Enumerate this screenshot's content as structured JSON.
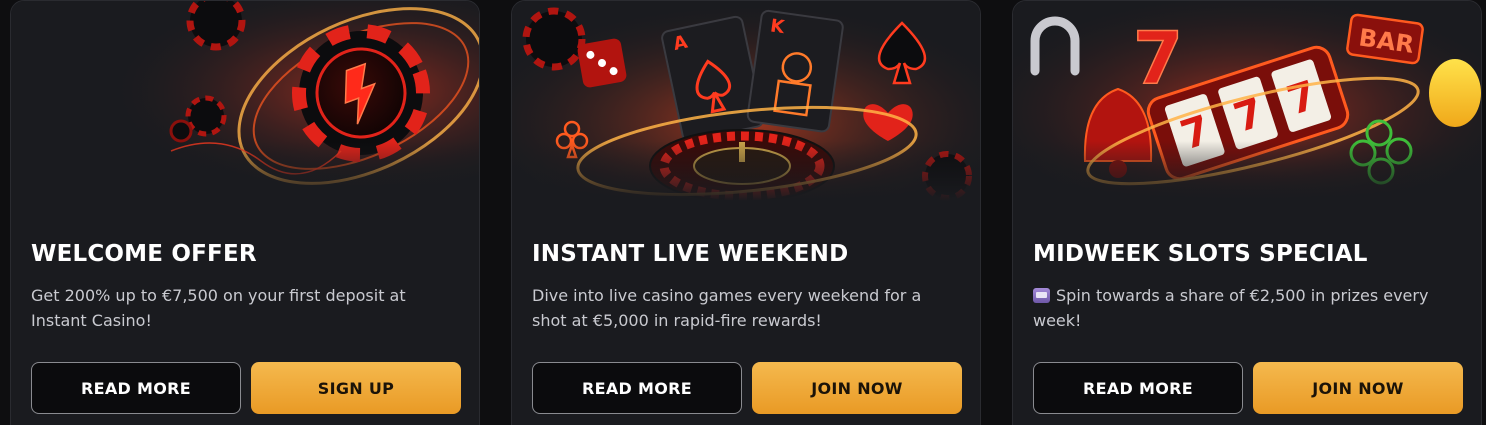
{
  "colors": {
    "page_bg": "#0e0e10",
    "card_bg": "#1a1b1f",
    "accent_gold": "#f0a83a",
    "accent_red": "#e2231a"
  },
  "promos": [
    {
      "banner_icon": "poker-chip-lightning-icon",
      "title": "WELCOME OFFER",
      "description": "Get 200% up to €7,500 on your first deposit at Instant Casino!",
      "secondary_button": "READ MORE",
      "primary_button": "SIGN UP"
    },
    {
      "banner_icon": "playing-cards-roulette-icon",
      "title": "INSTANT LIVE WEEKEND",
      "description": "Dive into live casino games every weekend for a shot at €5,000 in rapid-fire rewards!",
      "secondary_button": "READ MORE",
      "primary_button": "JOIN NOW"
    },
    {
      "banner_icon": "slot-machine-777-icon",
      "title": "MIDWEEK SLOTS SPECIAL",
      "description_icon": "slot-machine-emoji-icon",
      "description": "Spin towards a share of €2,500 in prizes every week!",
      "secondary_button": "READ MORE",
      "primary_button": "JOIN NOW"
    }
  ]
}
